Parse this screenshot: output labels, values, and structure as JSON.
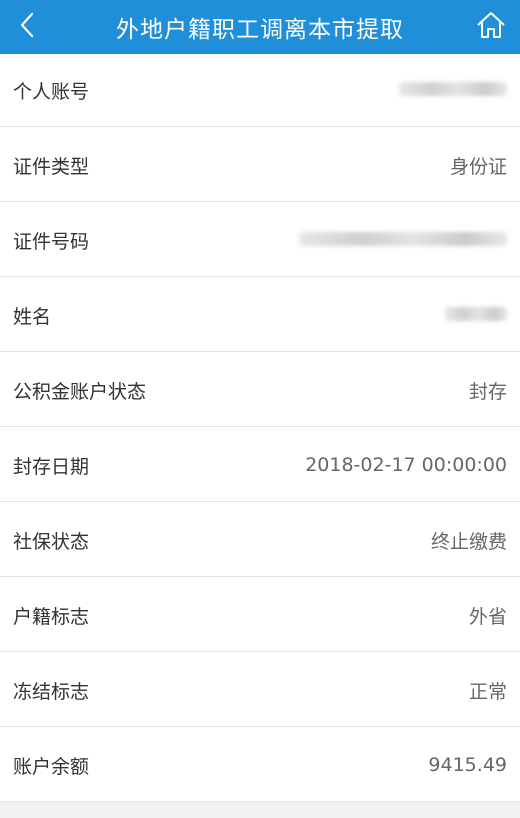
{
  "header": {
    "title": "外地户籍职工调离本市提取",
    "back_icon": "chevron-left-icon",
    "home_icon": "home-icon",
    "bar_color": "#1e8fd8"
  },
  "rows": [
    {
      "label": "个人账号",
      "value": "",
      "redacted": true
    },
    {
      "label": "证件类型",
      "value": "身份证"
    },
    {
      "label": "证件号码",
      "value": "",
      "redacted": true
    },
    {
      "label": "姓名",
      "value": "",
      "redacted": true
    },
    {
      "label": "公积金账户状态",
      "value": "封存"
    },
    {
      "label": "封存日期",
      "value": "2018-02-17 00:00:00"
    },
    {
      "label": "社保状态",
      "value": "终止缴费"
    },
    {
      "label": "户籍标志",
      "value": "外省"
    },
    {
      "label": "冻结标志",
      "value": "正常"
    },
    {
      "label": "账户余额",
      "value": "9415.49"
    }
  ]
}
